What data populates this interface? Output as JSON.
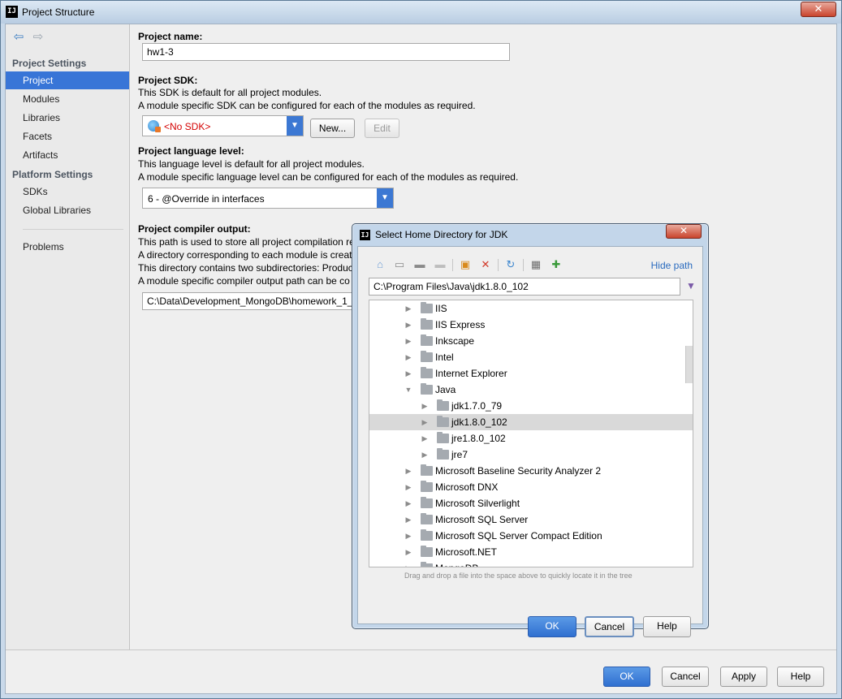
{
  "window": {
    "title": "Project Structure",
    "icon_text": "IJ",
    "close_glyph": "✕"
  },
  "sidebar": {
    "project_settings_heading": "Project Settings",
    "platform_settings_heading": "Platform Settings",
    "items": [
      {
        "label": "Project",
        "selected": true
      },
      {
        "label": "Modules"
      },
      {
        "label": "Libraries"
      },
      {
        "label": "Facets"
      },
      {
        "label": "Artifacts"
      },
      {
        "label": "SDKs"
      },
      {
        "label": "Global Libraries"
      },
      {
        "label": "Problems"
      }
    ]
  },
  "project": {
    "name_label": "Project name:",
    "name_value": "hw1-3",
    "sdk_label": "Project SDK:",
    "sdk_desc1": "This SDK is default for all project modules.",
    "sdk_desc2": "A module specific SDK can be configured for each of the modules as required.",
    "sdk_value": "<No SDK>",
    "sdk_new_button": "New...",
    "sdk_edit_button": "Edit",
    "lang_label": "Project language level:",
    "lang_desc1": "This language level is default for all project modules.",
    "lang_desc2": "A module specific language level can be configured for each of the modules as required.",
    "lang_value": "6 - @Override in interfaces",
    "compiler_label": "Project compiler output:",
    "compiler_desc1": "This path is used to store all project compilation re",
    "compiler_desc2": "A directory corresponding to each module is creat",
    "compiler_desc3": "This directory contains two subdirectories: Produc",
    "compiler_desc4": "A module specific compiler output path can be co",
    "compiler_value": "C:\\Data\\Development_MongoDB\\homework_1_"
  },
  "footer": {
    "ok": "OK",
    "cancel": "Cancel",
    "apply": "Apply",
    "help": "Help"
  },
  "dialog": {
    "title": "Select Home Directory for JDK",
    "icon_text": "IJ",
    "hide_path": "Hide path",
    "path_value": "C:\\Program Files\\Java\\jdk1.8.0_102",
    "hint": "Drag and drop a file into the space above to quickly locate it in the tree",
    "ok": "OK",
    "cancel": "Cancel",
    "help": "Help",
    "tree": [
      {
        "name": "IIS",
        "level": 0,
        "expanded": false
      },
      {
        "name": "IIS Express",
        "level": 0,
        "expanded": false
      },
      {
        "name": "Inkscape",
        "level": 0,
        "expanded": false
      },
      {
        "name": "Intel",
        "level": 0,
        "expanded": false
      },
      {
        "name": "Internet Explorer",
        "level": 0,
        "expanded": false
      },
      {
        "name": "Java",
        "level": 0,
        "expanded": true
      },
      {
        "name": "jdk1.7.0_79",
        "level": 1,
        "expanded": false
      },
      {
        "name": "jdk1.8.0_102",
        "level": 1,
        "expanded": false,
        "selected": true
      },
      {
        "name": "jre1.8.0_102",
        "level": 1,
        "expanded": false
      },
      {
        "name": "jre7",
        "level": 1,
        "expanded": false
      },
      {
        "name": "Microsoft Baseline Security Analyzer 2",
        "level": 0,
        "expanded": false
      },
      {
        "name": "Microsoft DNX",
        "level": 0,
        "expanded": false
      },
      {
        "name": "Microsoft Silverlight",
        "level": 0,
        "expanded": false
      },
      {
        "name": "Microsoft SQL Server",
        "level": 0,
        "expanded": false
      },
      {
        "name": "Microsoft SQL Server Compact Edition",
        "level": 0,
        "expanded": false
      },
      {
        "name": "Microsoft.NET",
        "level": 0,
        "expanded": false
      },
      {
        "name": "MongoDB",
        "level": 0,
        "expanded": false
      }
    ]
  }
}
